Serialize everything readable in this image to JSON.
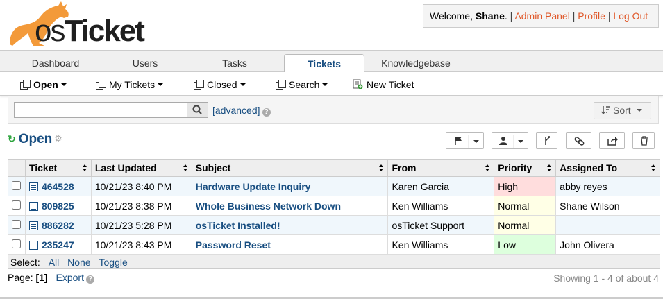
{
  "header": {
    "logo_os": "os",
    "logo_ticket": "Ticket",
    "welcome": "Welcome,",
    "user": "Shane",
    "admin_panel": "Admin Panel",
    "profile": "Profile",
    "logout": "Log Out"
  },
  "nav": {
    "tabs": [
      {
        "label": "Dashboard",
        "active": false
      },
      {
        "label": "Users",
        "active": false
      },
      {
        "label": "Tasks",
        "active": false
      },
      {
        "label": "Tickets",
        "active": true
      },
      {
        "label": "Knowledgebase",
        "active": false
      }
    ]
  },
  "subnav": {
    "open": "Open",
    "my_tickets": "My Tickets",
    "closed": "Closed",
    "search": "Search",
    "new_ticket": "New Ticket"
  },
  "search": {
    "value": "",
    "placeholder": "",
    "advanced": "[advanced]",
    "sort": "Sort"
  },
  "queue": {
    "title": "Open"
  },
  "table": {
    "headers": [
      "Ticket",
      "Last Updated",
      "Subject",
      "From",
      "Priority",
      "Assigned To"
    ],
    "rows": [
      {
        "ticket": "464528",
        "updated": "10/21/23 8:40 PM",
        "subject": "Hardware Update Inquiry",
        "from": "Karen Garcia",
        "priority": "High",
        "assigned": "abby reyes"
      },
      {
        "ticket": "809825",
        "updated": "10/21/23 8:38 PM",
        "subject": "Whole Business Network Down",
        "from": "Ken Williams",
        "priority": "Normal",
        "assigned": "Shane Wilson"
      },
      {
        "ticket": "886282",
        "updated": "10/21/23 5:28 PM",
        "subject": "osTicket Installed!",
        "from": "osTicket Support",
        "priority": "Normal",
        "assigned": ""
      },
      {
        "ticket": "235247",
        "updated": "10/21/23 8:43 PM",
        "subject": "Password Reset",
        "from": "Ken Williams",
        "priority": "Low",
        "assigned": "John Olivera"
      }
    ]
  },
  "select": {
    "label": "Select:",
    "all": "All",
    "none": "None",
    "toggle": "Toggle"
  },
  "paging": {
    "label": "Page:",
    "current": "[1]",
    "export": "Export",
    "showing": "Showing 1 - 4 of about 4"
  },
  "colors": {
    "accent": "#184e81",
    "link_orange": "#e0582a",
    "logo_orange": "#f39a3a",
    "priority_high": "#ffdddd",
    "priority_normal": "#ffffe6",
    "priority_low": "#ddffdd"
  }
}
